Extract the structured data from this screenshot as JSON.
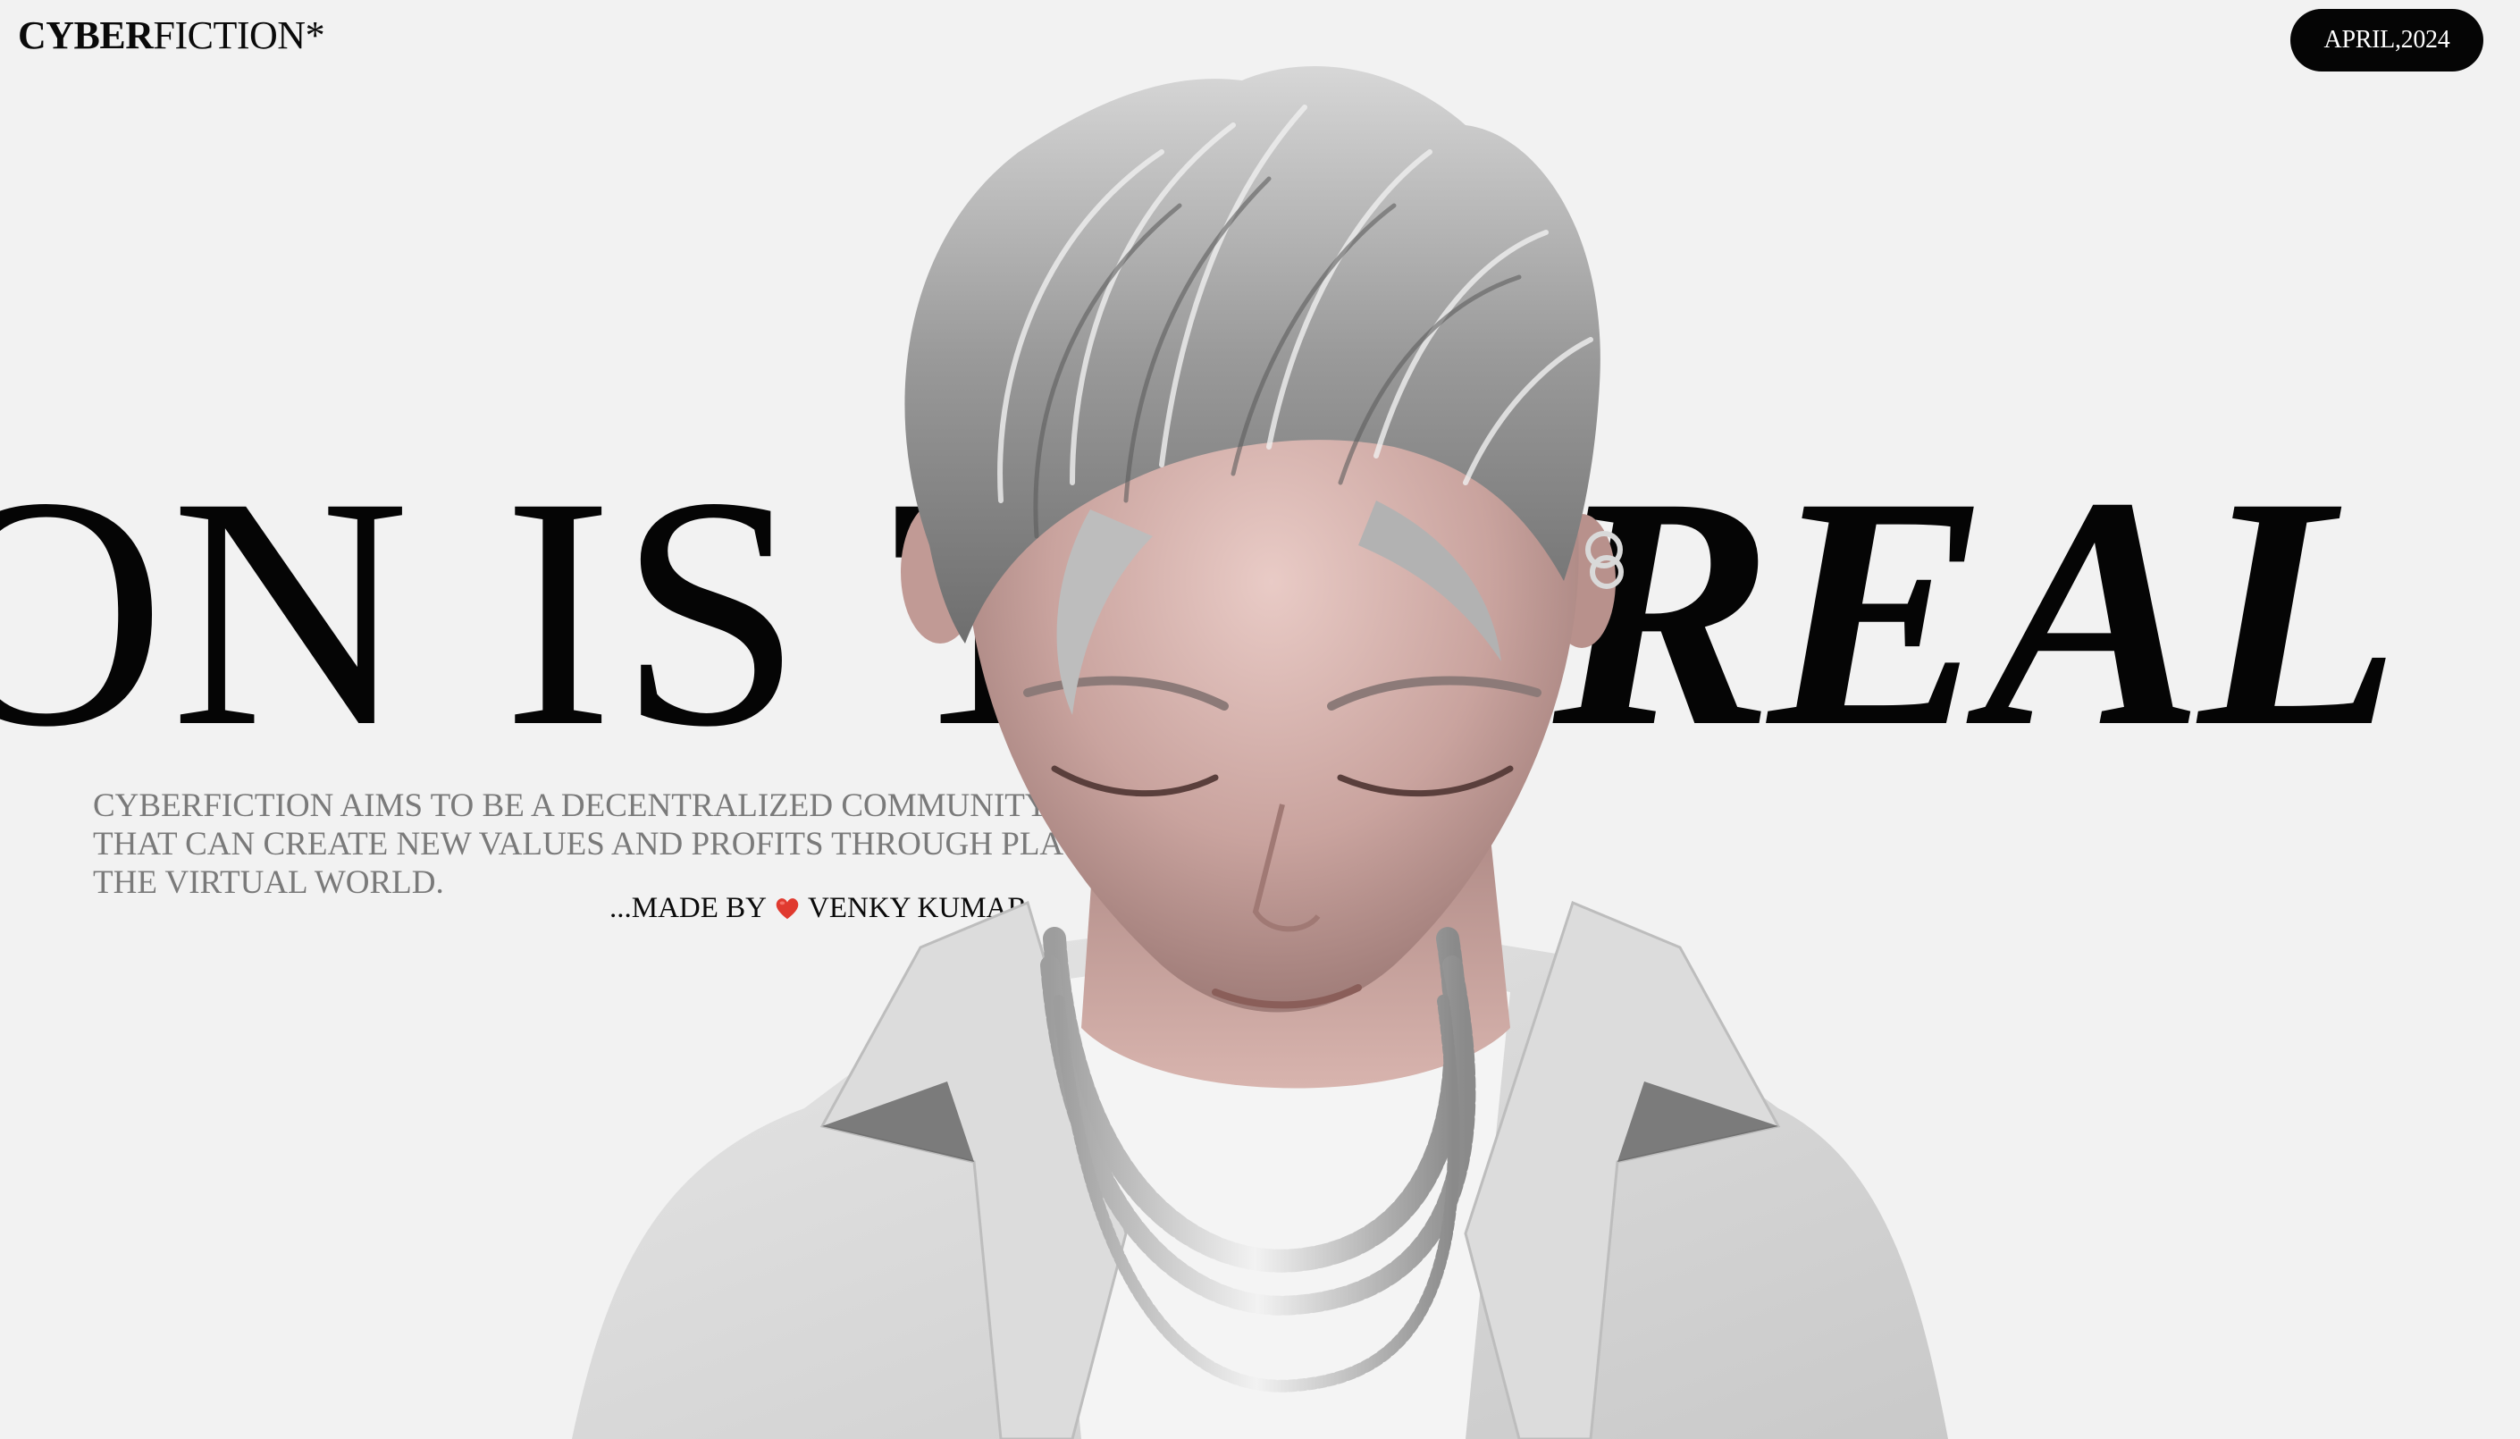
{
  "header": {
    "logo_bold": "CYBER",
    "logo_regular": "FICTION*",
    "date": "APRIL,2024"
  },
  "hero": {
    "headline_left": "ON IS T",
    "headline_right": "REAL",
    "description": "CYBERFICTION AIMS TO BE A DECENTRALIZED COMMUNITY THAT CAN CREATE NEW VALUES AND PROFITS THROUGH PLAY IN THE VIRTUAL WORLD.",
    "credit_prefix": "...MADE BY",
    "credit_name": "VENKY KUMAR",
    "heart_icon": "heart-icon"
  },
  "colors": {
    "background": "#f2f2f2",
    "ink": "#050505",
    "muted": "#7a7a7a",
    "heart": "#e03a2f"
  }
}
